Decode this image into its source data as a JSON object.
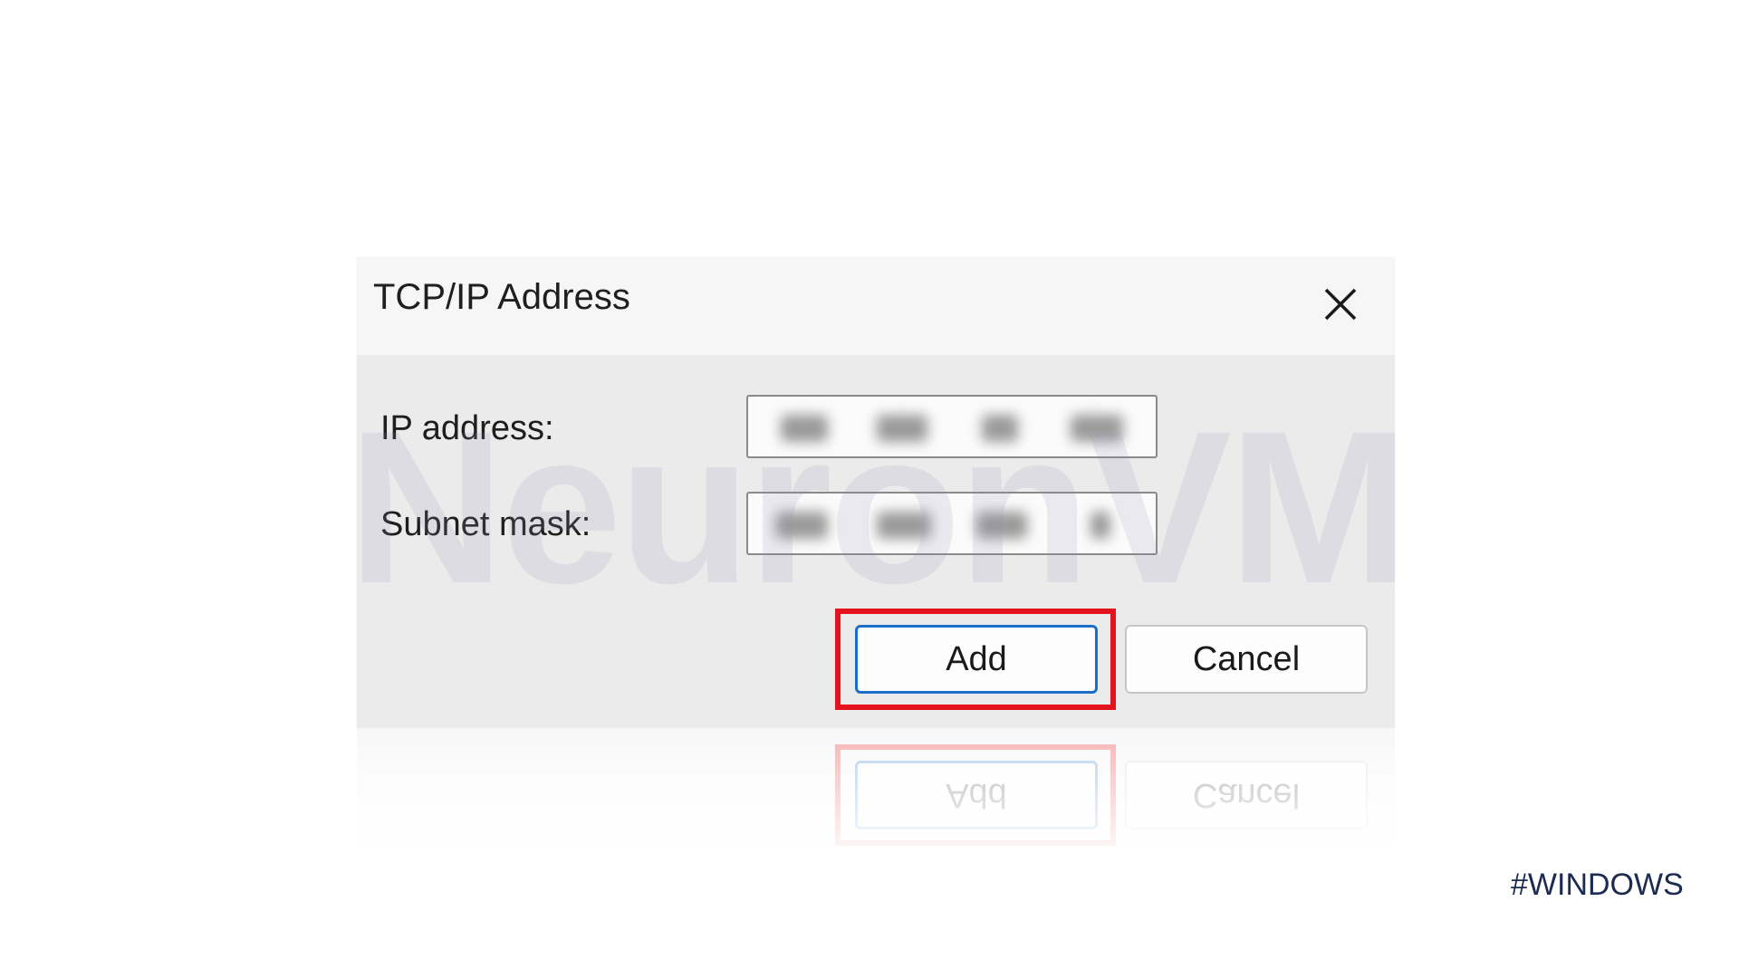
{
  "dialog": {
    "title": "TCP/IP Address",
    "close_icon": "close-icon",
    "fields": [
      {
        "label": "IP address:",
        "value_state": "blurred"
      },
      {
        "label": "Subnet mask:",
        "value_state": "blurred"
      }
    ],
    "buttons": {
      "add_label": "Add",
      "cancel_label": "Cancel"
    },
    "highlighted_button": "Add"
  },
  "watermark": "NeuronVM",
  "tag": "#WINDOWS",
  "colors": {
    "highlight": "#e2131b",
    "focus_border": "#1c6fc9",
    "dialog_body": "#ebebeb",
    "titlebar": "#f6f6f6",
    "tag_text": "#1b2b52"
  }
}
